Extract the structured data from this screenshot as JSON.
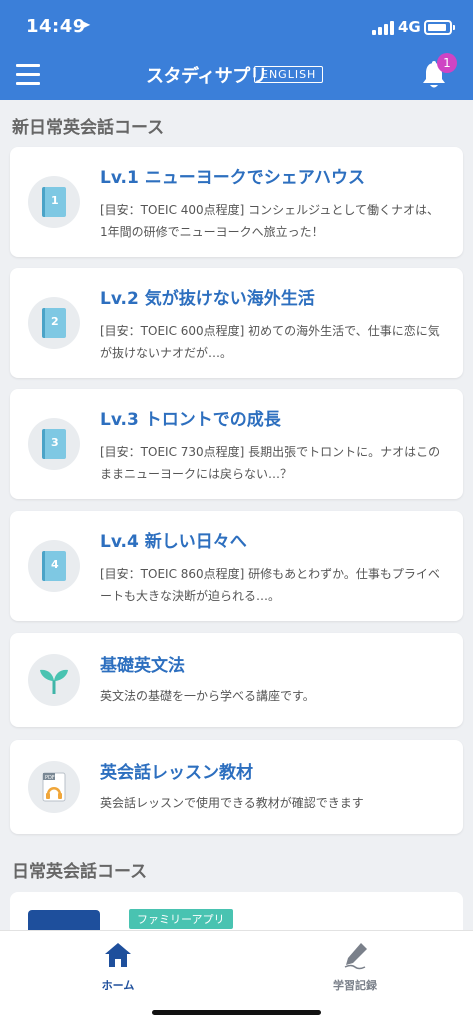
{
  "status": {
    "time": "14:49",
    "network": "4G"
  },
  "header": {
    "brand": "スタディサプリ",
    "brand_tag": "ENGLISH",
    "notification_count": "1"
  },
  "sections": [
    {
      "title": "新日常英会話コース"
    },
    {
      "title": "日常英会話コース"
    }
  ],
  "courses": [
    {
      "title": "Lv.1 ニューヨークでシェアハウス",
      "desc": "[目安：TOEIC 400点程度] コンシェルジュとして働くナオは、1年間の研修でニューヨークへ旅立った！",
      "icon": "book-1-icon",
      "number": "1"
    },
    {
      "title": "Lv.2 気が抜けない海外生活",
      "desc": "[目安：TOEIC 600点程度] 初めての海外生活で、仕事に恋に気が抜けないナオだが…。",
      "icon": "book-2-icon",
      "number": "2"
    },
    {
      "title": "Lv.3 トロントでの成長",
      "desc": "[目安：TOEIC 730点程度] 長期出張でトロントに。ナオはこのままニューヨークには戻らない…？",
      "icon": "book-3-icon",
      "number": "3"
    },
    {
      "title": "Lv.4 新しい日々へ",
      "desc": "[目安：TOEIC 860点程度] 研修もあとわずか。仕事もプライベートも大きな決断が迫られる…。",
      "icon": "book-4-icon",
      "number": "4"
    },
    {
      "title": "基礎英文法",
      "desc": "英文法の基礎を一から学べる講座です。",
      "icon": "sprout-icon"
    },
    {
      "title": "英会話レッスン教材",
      "desc": "英会話レッスンで使用できる教材が確認できます",
      "icon": "pdf-headphones-icon",
      "pdf_label": "PDF"
    }
  ],
  "partial_card": {
    "tag": "ファミリーアプリ"
  },
  "tabs": [
    {
      "label": "ホーム",
      "icon": "home-icon",
      "active": true
    },
    {
      "label": "学習記録",
      "icon": "pen-icon",
      "active": false
    }
  ],
  "colors": {
    "header": "#3b7fd9",
    "title": "#2d6fbf",
    "badge": "#cf44c4",
    "tag": "#49c3b1"
  }
}
